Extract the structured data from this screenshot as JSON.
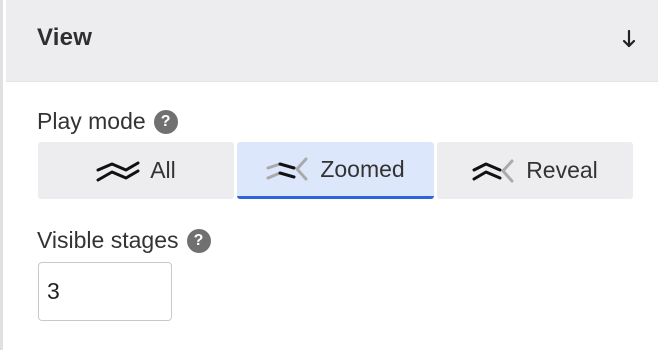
{
  "panel": {
    "title": "View",
    "collapse_icon": "arrow-down-icon"
  },
  "play_mode": {
    "label": "Play mode",
    "help": "?",
    "options": [
      {
        "label": "All",
        "icon": "mode-all-icon",
        "active": false
      },
      {
        "label": "Zoomed",
        "icon": "mode-zoomed-icon",
        "active": true
      },
      {
        "label": "Reveal",
        "icon": "mode-reveal-icon",
        "active": false
      }
    ]
  },
  "visible_stages": {
    "label": "Visible stages",
    "help": "?",
    "value": "3"
  },
  "colors": {
    "accent": "#2a66d9",
    "active_bg": "#dde7fb",
    "header_bg": "#ededef"
  }
}
